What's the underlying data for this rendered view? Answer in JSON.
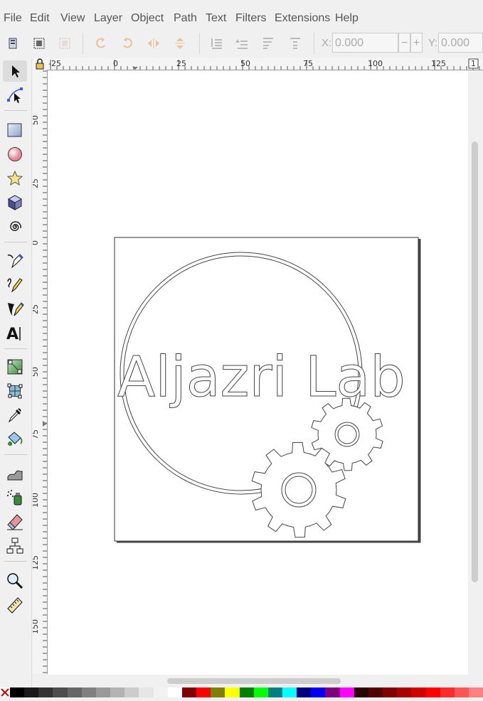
{
  "menubar": {
    "items": [
      {
        "label": "File"
      },
      {
        "label": "Edit"
      },
      {
        "label": "View"
      },
      {
        "label": "Layer"
      },
      {
        "label": "Object"
      },
      {
        "label": "Path"
      },
      {
        "label": "Text"
      },
      {
        "label": "Filters"
      },
      {
        "label": "Extensions"
      },
      {
        "label": "Help"
      }
    ]
  },
  "commandbar": {
    "x_label": "X:",
    "x_value": "0.000",
    "minus_label": "−",
    "plus_label": "+",
    "y_label": "Y:",
    "y_value": "0.000"
  },
  "rulers": {
    "horizontal_ticks": [
      "-25",
      "0",
      "25",
      "50",
      "75",
      "100",
      "125",
      "1"
    ],
    "vertical_ticks": [
      "50",
      "25",
      "0",
      "25",
      "50",
      "75",
      "100",
      "125",
      "150"
    ]
  },
  "canvas": {
    "logo_text": "Aljazri Lab"
  },
  "palette": {
    "colors": [
      "#000000",
      "#1a1a1a",
      "#333333",
      "#4d4d4d",
      "#666666",
      "#808080",
      "#999999",
      "#b3b3b3",
      "#cccccc",
      "#e6e6e6",
      "#f2f2f2",
      "#ffffff",
      "#800000",
      "#ff0000",
      "#808000",
      "#ffff00",
      "#008000",
      "#00ff00",
      "#008080",
      "#00ffff",
      "#000080",
      "#0000ff",
      "#800080",
      "#ff00ff",
      "#2b0000",
      "#550000",
      "#800000",
      "#aa0000",
      "#d40000",
      "#ff0000",
      "#ff2a2a",
      "#ff5555",
      "#ff8080"
    ]
  }
}
